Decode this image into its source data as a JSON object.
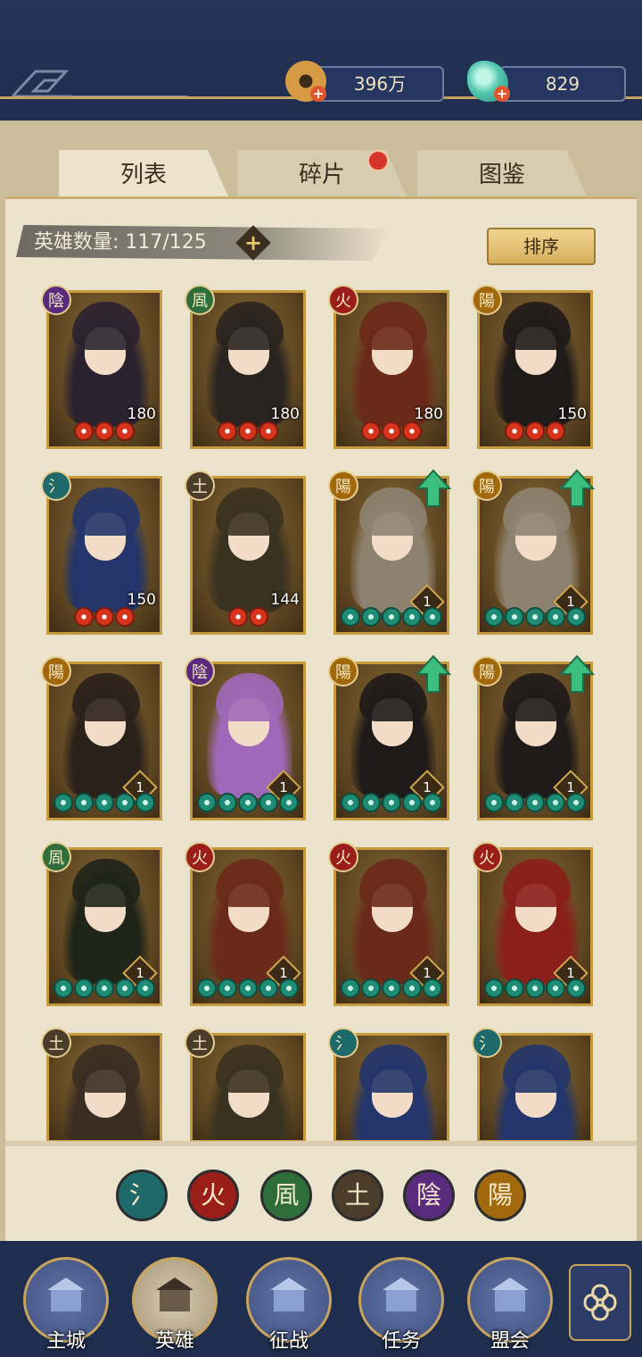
{
  "topbar": {
    "currency_coins": "396万",
    "currency_jade": "829",
    "plus_symbol": "+"
  },
  "tabs": [
    {
      "label": "列表",
      "active": true
    },
    {
      "label": "碎片",
      "active": false,
      "badge": true
    },
    {
      "label": "图鉴",
      "active": false
    }
  ],
  "hero_count": {
    "label": "英雄数量: 117/125",
    "plus": "+"
  },
  "sort_button": "排序",
  "elements": {
    "water": {
      "glyph": "氵",
      "color": "#1e6a6a"
    },
    "fire": {
      "glyph": "火",
      "color": "#9a1f1a"
    },
    "wind": {
      "glyph": "凮",
      "color": "#2f6e3a"
    },
    "earth": {
      "glyph": "土",
      "color": "#4b3d2a"
    },
    "yin": {
      "glyph": "陰",
      "color": "#5a2b7d"
    },
    "yang": {
      "glyph": "陽",
      "color": "#a1690c"
    }
  },
  "heroes": [
    {
      "element": "yin",
      "level": "180",
      "stars": 3,
      "star_type": "red",
      "upgrade": false,
      "palette": "#2b2230"
    },
    {
      "element": "wind",
      "level": "180",
      "stars": 3,
      "star_type": "red",
      "upgrade": false,
      "palette": "#2a2420"
    },
    {
      "element": "fire",
      "level": "180",
      "stars": 3,
      "star_type": "red",
      "upgrade": false,
      "palette": "#6a2a1a"
    },
    {
      "element": "yang",
      "level": "150",
      "stars": 3,
      "star_type": "red",
      "upgrade": false,
      "palette": "#1f1a1a"
    },
    {
      "element": "water",
      "level": "150",
      "stars": 3,
      "star_type": "red",
      "upgrade": false,
      "palette": "#23356a"
    },
    {
      "element": "earth",
      "level": "144",
      "stars": 2,
      "star_type": "red",
      "upgrade": false,
      "palette": "#3a3220"
    },
    {
      "element": "yang",
      "level": "1",
      "stars": 5,
      "star_type": "green",
      "upgrade": true,
      "palette": "#8d8270"
    },
    {
      "element": "yang",
      "level": "1",
      "stars": 5,
      "star_type": "green",
      "upgrade": true,
      "palette": "#8d8270"
    },
    {
      "element": "yang",
      "level": "1",
      "stars": 5,
      "star_type": "green",
      "upgrade": false,
      "palette": "#2a211b"
    },
    {
      "element": "yin",
      "level": "1",
      "stars": 5,
      "star_type": "green",
      "upgrade": false,
      "palette": "#a068b8"
    },
    {
      "element": "yang",
      "level": "1",
      "stars": 5,
      "star_type": "green",
      "upgrade": true,
      "palette": "#1f1a1a"
    },
    {
      "element": "yang",
      "level": "1",
      "stars": 5,
      "star_type": "green",
      "upgrade": true,
      "palette": "#1f1a1a"
    },
    {
      "element": "wind",
      "level": "1",
      "stars": 5,
      "star_type": "green",
      "upgrade": false,
      "palette": "#1f2418"
    },
    {
      "element": "fire",
      "level": "1",
      "stars": 5,
      "star_type": "green",
      "upgrade": false,
      "palette": "#6a2a1a"
    },
    {
      "element": "fire",
      "level": "1",
      "stars": 5,
      "star_type": "green",
      "upgrade": false,
      "palette": "#6a2a1a"
    },
    {
      "element": "fire",
      "level": "1",
      "stars": 5,
      "star_type": "green",
      "upgrade": false,
      "palette": "#8a1f1a"
    },
    {
      "element": "earth",
      "level": "",
      "stars": 0,
      "star_type": "green",
      "upgrade": false,
      "palette": "#3a2d22"
    },
    {
      "element": "earth",
      "level": "",
      "stars": 0,
      "star_type": "green",
      "upgrade": false,
      "palette": "#3a3220"
    },
    {
      "element": "water",
      "level": "",
      "stars": 0,
      "star_type": "green",
      "upgrade": false,
      "palette": "#23356a"
    },
    {
      "element": "water",
      "level": "",
      "stars": 0,
      "star_type": "green",
      "upgrade": false,
      "palette": "#23356a"
    }
  ],
  "filters": [
    "water",
    "fire",
    "wind",
    "earth",
    "yin",
    "yang"
  ],
  "nav": [
    {
      "label": "主城",
      "icon": "city-gate-icon",
      "active": false
    },
    {
      "label": "英雄",
      "icon": "hero-portrait-icon",
      "active": true
    },
    {
      "label": "征战",
      "icon": "battle-icon",
      "active": false
    },
    {
      "label": "任务",
      "icon": "quest-scroll-icon",
      "active": false
    },
    {
      "label": "盟会",
      "icon": "guild-hall-icon",
      "active": false
    }
  ]
}
